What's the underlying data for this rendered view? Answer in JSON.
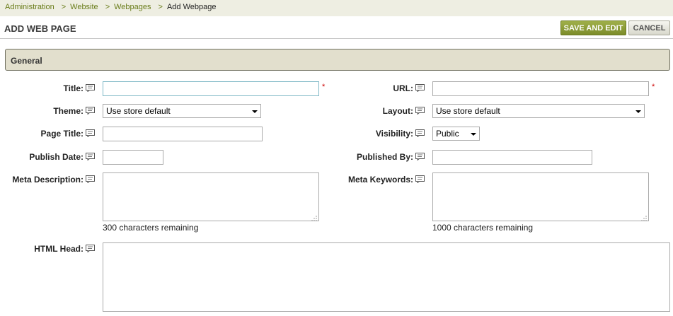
{
  "breadcrumb": {
    "items": [
      "Administration",
      "Website",
      "Webpages"
    ],
    "current": "Add Webpage",
    "separator": ">"
  },
  "header": {
    "title": "ADD WEB PAGE",
    "save_label": "SAVE AND EDIT",
    "cancel_label": "CANCEL"
  },
  "section": {
    "title": "General"
  },
  "form": {
    "title_label": "Title:",
    "url_label": "URL:",
    "theme_label": "Theme:",
    "theme_value": "Use store default",
    "layout_label": "Layout:",
    "layout_value": "Use store default",
    "page_title_label": "Page Title:",
    "visibility_label": "Visibility:",
    "visibility_value": "Public",
    "publish_date_label": "Publish Date:",
    "published_by_label": "Published By:",
    "meta_description_label": "Meta Description:",
    "meta_description_remaining": "300 characters remaining",
    "meta_keywords_label": "Meta Keywords:",
    "meta_keywords_remaining": "1000 characters remaining",
    "html_head_label": "HTML Head:",
    "required_marker": "*"
  },
  "colors": {
    "breadcrumb_link": "#6a7d1a",
    "save_button": "#8a9a3a",
    "section_background": "#e2dfcd",
    "required": "#cc0000"
  },
  "icons": {
    "help": "speech-bubble-icon",
    "select": "chevron-down-icon",
    "resize": "resize-grip-icon"
  }
}
